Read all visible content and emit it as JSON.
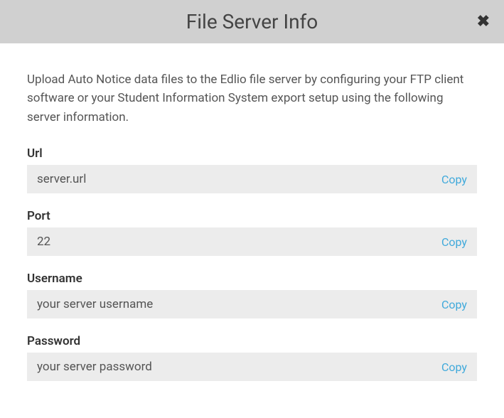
{
  "header": {
    "title": "File Server Info",
    "close_glyph": "✖"
  },
  "description": "Upload Auto Notice data files to the Edlio file server by configuring your FTP client software or your Student Information System export setup using the following server information.",
  "fields": {
    "url": {
      "label": "Url",
      "value": "server.url",
      "copy_label": "Copy"
    },
    "port": {
      "label": "Port",
      "value": "22",
      "copy_label": "Copy"
    },
    "username": {
      "label": "Username",
      "value": "your server username",
      "copy_label": "Copy"
    },
    "password": {
      "label": "Password",
      "value": "your server password",
      "copy_label": "Copy"
    }
  }
}
